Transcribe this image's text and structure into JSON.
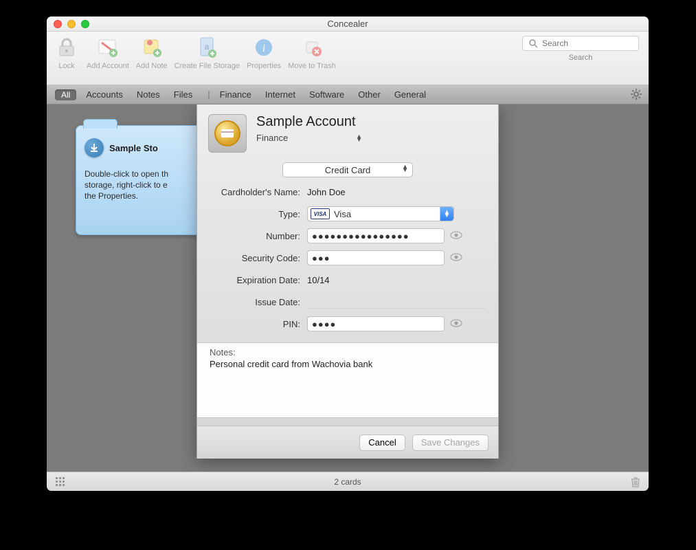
{
  "window": {
    "title": "Concealer"
  },
  "toolbar": {
    "items": [
      {
        "label": "Lock"
      },
      {
        "label": "Add Account"
      },
      {
        "label": "Add Note"
      },
      {
        "label": "Create File Storage"
      },
      {
        "label": "Properties"
      },
      {
        "label": "Move to Trash"
      }
    ],
    "search_placeholder": "Search",
    "search_label": "Search"
  },
  "filterbar": {
    "all": "All",
    "items": [
      "Accounts",
      "Notes",
      "Files"
    ],
    "categories": [
      "Finance",
      "Internet",
      "Software",
      "Other",
      "General"
    ]
  },
  "folder": {
    "title": "Sample Sto",
    "desc1": "Double-click to open th",
    "desc2": "storage, right-click to e",
    "desc3": "the Properties."
  },
  "panel": {
    "title": "Sample Account",
    "category": "Finance",
    "subtype": "Credit Card",
    "fields": {
      "cardholder_label": "Cardholder's Name:",
      "cardholder_value": "John Doe",
      "type_label": "Type:",
      "type_value": "Visa",
      "number_label": "Number:",
      "number_value": "●●●●●●●●●●●●●●●●",
      "security_label": "Security Code:",
      "security_value": "●●●",
      "expiration_label": "Expiration Date:",
      "expiration_value": "10/14",
      "issue_label": "Issue Date:",
      "issue_value": "",
      "pin_label": "PIN:",
      "pin_value": "●●●●"
    },
    "notes_label": "Notes:",
    "notes_text": "Personal credit card from Wachovia bank",
    "cancel": "Cancel",
    "save": "Save Changes"
  },
  "statusbar": {
    "text": "2 cards"
  }
}
